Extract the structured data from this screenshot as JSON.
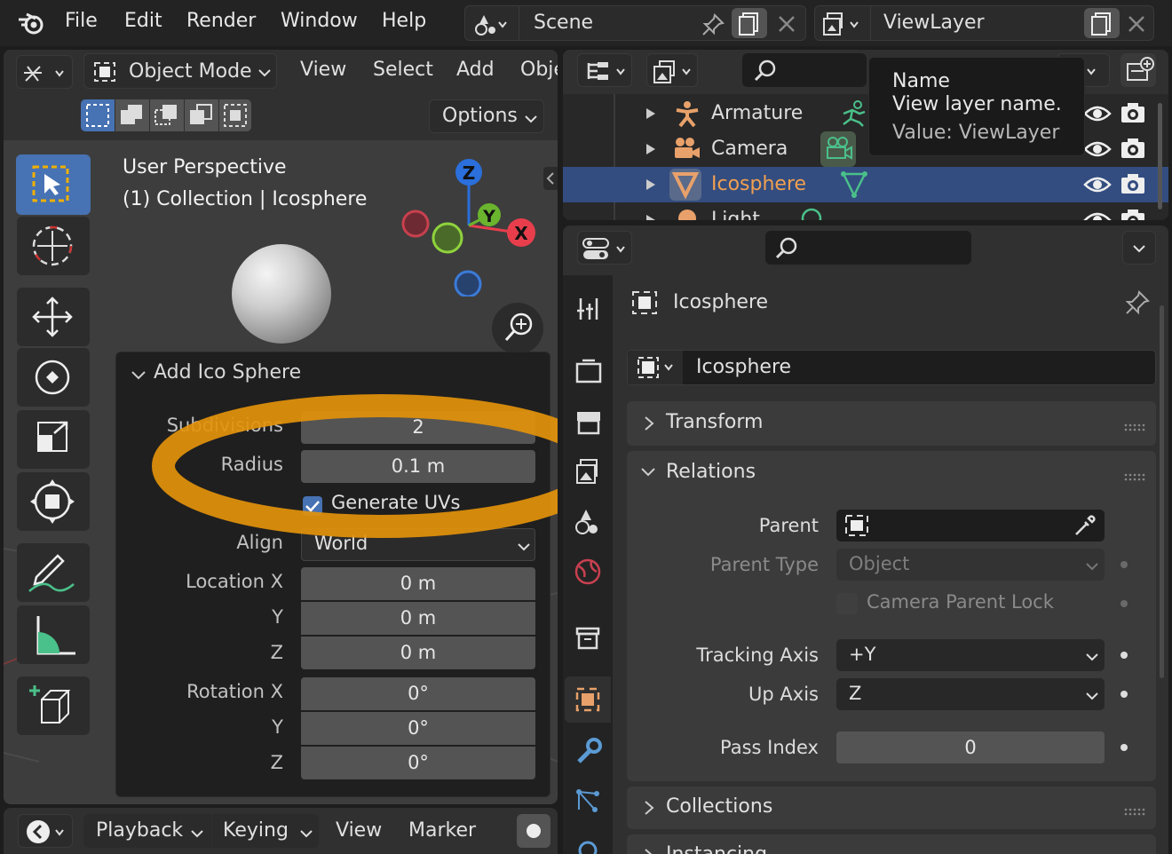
{
  "topbar": {
    "menu": [
      "File",
      "Edit",
      "Render",
      "Window",
      "Help"
    ],
    "scene": "Scene",
    "view_layer": "ViewLayer"
  },
  "viewport": {
    "mode": "Object Mode",
    "menu": [
      "View",
      "Select",
      "Add",
      "Obje"
    ],
    "options": "Options",
    "overlay_line1": "User Perspective",
    "overlay_line2": "(1) Collection | Icosphere",
    "gizmo": {
      "z": "Z",
      "y": "Y",
      "x": "X"
    }
  },
  "operator_panel": {
    "title": "Add Ico Sphere",
    "subdivisions_label": "Subdivisions",
    "subdivisions": "2",
    "radius_label": "Radius",
    "radius": "0.1 m",
    "generate_uvs": "Generate UVs",
    "align_label": "Align",
    "align": "World",
    "location_label": "Location X",
    "loc_x": "0 m",
    "loc_y": "0 m",
    "loc_z": "0 m",
    "rotation_label": "Rotation X",
    "rot_x": "0°",
    "rot_y": "0°",
    "rot_z": "0°",
    "y": "Y",
    "z": "Z"
  },
  "timeline": {
    "menu": [
      "Playback",
      "Keying",
      "View",
      "Marker"
    ]
  },
  "outliner": {
    "items": [
      "Armature",
      "Camera",
      "Icosphere",
      "Light"
    ],
    "selected_index": 2
  },
  "tooltip": {
    "title": "Name",
    "desc": "View layer name.",
    "value": "Value: ViewLayer"
  },
  "properties": {
    "object_name_header": "Icosphere",
    "object_name": "Icosphere",
    "sections": {
      "transform": "Transform",
      "relations": "Relations",
      "collections": "Collections",
      "instancing": "Instancing"
    },
    "parent_label": "Parent",
    "parent_type_label": "Parent Type",
    "parent_type": "Object",
    "camera_parent_lock": "Camera Parent Lock",
    "tracking_axis_label": "Tracking Axis",
    "tracking_axis": "+Y",
    "up_axis_label": "Up Axis",
    "up_axis": "Z",
    "pass_index_label": "Pass Index",
    "pass_index": "0"
  },
  "colors": {
    "accent_blue": "#4772b3",
    "highlight_orange": "#e3920b",
    "object_orange": "#e8a16a"
  }
}
